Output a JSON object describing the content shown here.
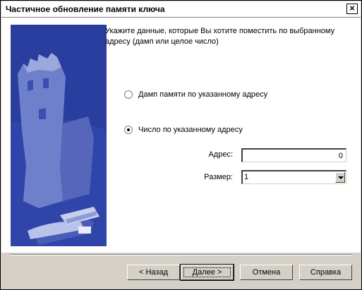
{
  "window": {
    "title": "Частичное обновление памяти ключа",
    "close_label": "×"
  },
  "instruction": "Укажите данные, которые Вы хотите поместить по выбранному адресу (дамп или целое число)",
  "options": [
    {
      "label": "Дамп памяти по указанному адресу",
      "selected": false
    },
    {
      "label": "Число по указанному адресу",
      "selected": true
    }
  ],
  "fields": {
    "address": {
      "label": "Адрес:",
      "value": "0"
    },
    "size": {
      "label": "Размер:",
      "value": "1"
    }
  },
  "buttons": {
    "back": "< Назад",
    "next": "Далее >",
    "cancel": "Отмена",
    "help": "Справка"
  },
  "colors": {
    "banner_blue": "#2a3ea0",
    "dialog_gray": "#d4d0c8"
  },
  "icons": {
    "close": "close-icon",
    "dropdown": "chevron-down-icon"
  }
}
